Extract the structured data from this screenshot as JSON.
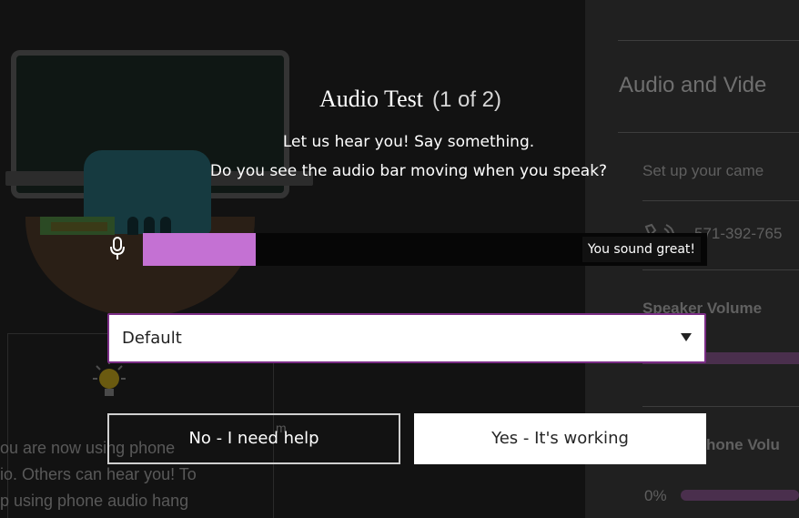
{
  "background": {
    "right_panel": {
      "title": "Audio and Vide",
      "setup_text": "Set up your came",
      "phone_number": "571-392-765",
      "speaker_volume_label": "Speaker Volume",
      "microphone_volume_label": "hone Volu",
      "microphone_volume_value": "0%"
    },
    "left_message": {
      "line1": "ou are now using phone",
      "line2": "io. Others can hear you! To",
      "line3": "p using phone audio hang"
    },
    "stray_char": "m"
  },
  "modal": {
    "title": "Audio Test",
    "step": "(1 of 2)",
    "prompt_line1": "Let us hear you! Say something.",
    "prompt_line2": "Do you see the audio bar moving when you speak?",
    "meter": {
      "level_fraction": 0.2,
      "fill_color": "#c471d3",
      "status_text": "You sound great!"
    },
    "device_select": {
      "selected": "Default"
    },
    "buttons": {
      "no_label": "No - I need help",
      "yes_label": "Yes - It's working"
    }
  }
}
